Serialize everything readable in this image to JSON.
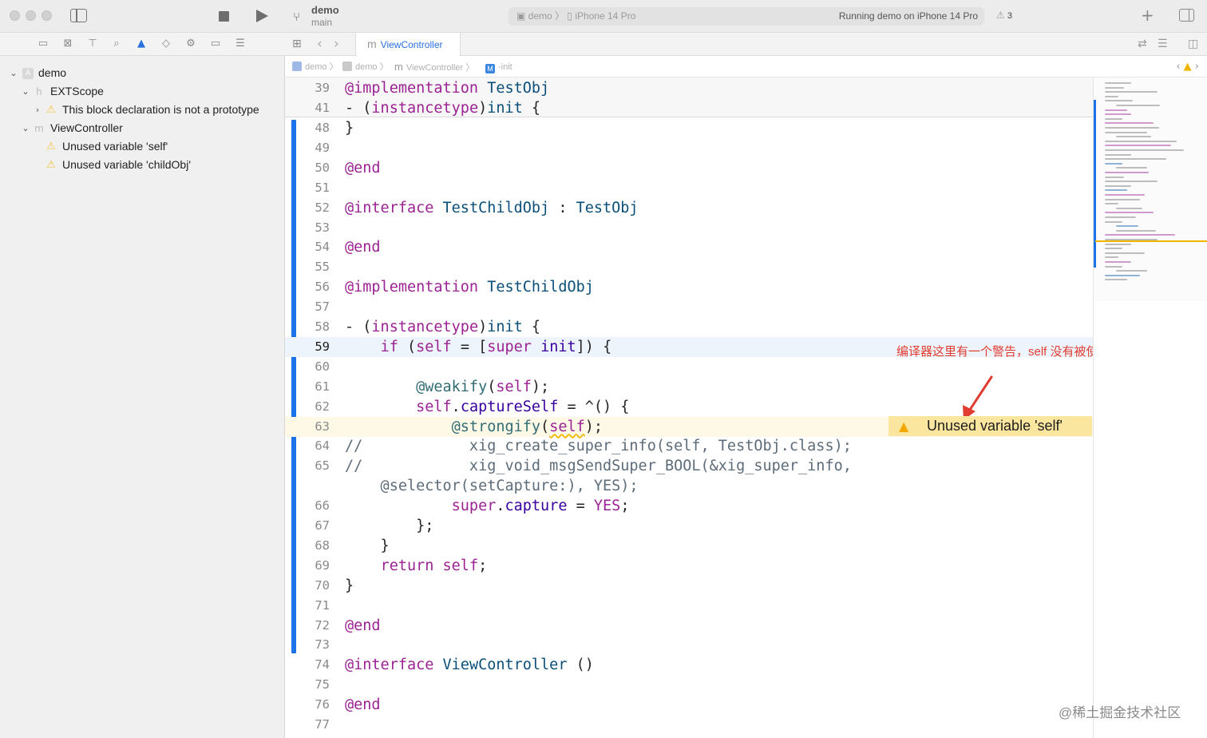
{
  "toolbar": {
    "scheme_name": "demo",
    "branch": "main",
    "activity_scheme": "demo",
    "activity_device": "iPhone 14 Pro",
    "activity_status": "Running demo on iPhone 14 Pro",
    "warning_count": "3"
  },
  "navigator": {
    "tree": [
      {
        "label": "demo",
        "kind": "project",
        "icon": "project-icon"
      },
      {
        "label": "EXTScope",
        "kind": "header-file",
        "icon": "header-file-icon"
      },
      {
        "label": "This block declaration is not a prototype",
        "kind": "warning",
        "icon": "warning-icon"
      },
      {
        "label": "ViewController",
        "kind": "source-file",
        "icon": "objc-file-icon"
      },
      {
        "label": "Unused variable 'self'",
        "kind": "warning",
        "icon": "warning-icon"
      },
      {
        "label": "Unused variable 'childObj'",
        "kind": "warning",
        "icon": "warning-icon"
      }
    ]
  },
  "tab": {
    "icon_letter": "m",
    "label": "ViewController"
  },
  "jumpbar": {
    "items": [
      "demo",
      "demo",
      "ViewController",
      "-init"
    ],
    "method_badge": "M"
  },
  "editor": {
    "sticky_lines": [
      {
        "num": "39",
        "segments": [
          {
            "t": "@implementation",
            "c": "kw"
          },
          {
            "t": " ",
            "c": ""
          },
          {
            "t": "TestObj",
            "c": "ty"
          }
        ]
      },
      {
        "num": "41",
        "segments": [
          {
            "t": "- (",
            "c": ""
          },
          {
            "t": "instancetype",
            "c": "kw"
          },
          {
            "t": ")",
            "c": ""
          },
          {
            "t": "init",
            "c": "ty"
          },
          {
            "t": " {",
            "c": ""
          }
        ]
      }
    ],
    "lines": [
      {
        "num": "48",
        "segments": [
          {
            "t": "}",
            "c": ""
          }
        ]
      },
      {
        "num": "49",
        "segments": []
      },
      {
        "num": "50",
        "segments": [
          {
            "t": "@end",
            "c": "kw"
          }
        ]
      },
      {
        "num": "51",
        "segments": []
      },
      {
        "num": "52",
        "segments": [
          {
            "t": "@interface",
            "c": "kw"
          },
          {
            "t": " ",
            "c": ""
          },
          {
            "t": "TestChildObj",
            "c": "ty"
          },
          {
            "t": " : ",
            "c": ""
          },
          {
            "t": "TestObj",
            "c": "ty"
          }
        ]
      },
      {
        "num": "53",
        "segments": []
      },
      {
        "num": "54",
        "segments": [
          {
            "t": "@end",
            "c": "kw"
          }
        ]
      },
      {
        "num": "55",
        "segments": []
      },
      {
        "num": "56",
        "segments": [
          {
            "t": "@implementation",
            "c": "kw"
          },
          {
            "t": " ",
            "c": ""
          },
          {
            "t": "TestChildObj",
            "c": "ty"
          }
        ]
      },
      {
        "num": "57",
        "segments": []
      },
      {
        "num": "58",
        "segments": [
          {
            "t": "- (",
            "c": ""
          },
          {
            "t": "instancetype",
            "c": "kw"
          },
          {
            "t": ")",
            "c": ""
          },
          {
            "t": "init",
            "c": "ty"
          },
          {
            "t": " {",
            "c": ""
          }
        ]
      },
      {
        "num": "59",
        "current": true,
        "segments": [
          {
            "t": "    ",
            "c": ""
          },
          {
            "t": "if",
            "c": "kw"
          },
          {
            "t": " (",
            "c": ""
          },
          {
            "t": "self",
            "c": "kw"
          },
          {
            "t": " = [",
            "c": ""
          },
          {
            "t": "super",
            "c": "kw"
          },
          {
            "t": " ",
            "c": ""
          },
          {
            "t": "init",
            "c": "pr"
          },
          {
            "t": "]) {",
            "c": ""
          }
        ]
      },
      {
        "num": "60",
        "segments": []
      },
      {
        "num": "61",
        "segments": [
          {
            "t": "        ",
            "c": ""
          },
          {
            "t": "@weakify",
            "c": "fn"
          },
          {
            "t": "(",
            "c": ""
          },
          {
            "t": "self",
            "c": "kw"
          },
          {
            "t": ");",
            "c": ""
          }
        ]
      },
      {
        "num": "62",
        "segments": [
          {
            "t": "        ",
            "c": ""
          },
          {
            "t": "self",
            "c": "kw"
          },
          {
            "t": ".",
            "c": ""
          },
          {
            "t": "captureSelf",
            "c": "pr"
          },
          {
            "t": " = ^() {",
            "c": ""
          }
        ]
      },
      {
        "num": "63",
        "warn": true,
        "segments": [
          {
            "t": "            ",
            "c": ""
          },
          {
            "t": "@strongify",
            "c": "fn"
          },
          {
            "t": "(",
            "c": ""
          },
          {
            "t": "self",
            "c": "kw uline"
          },
          {
            "t": ");",
            "c": ""
          }
        ]
      },
      {
        "num": "64",
        "segments": [
          {
            "t": "//            xig_create_super_info(self, TestObj.class);",
            "c": "cm"
          }
        ]
      },
      {
        "num": "65",
        "segments": [
          {
            "t": "//            xig_void_msgSendSuper_BOOL(&xig_super_info,",
            "c": "cm"
          }
        ]
      },
      {
        "num": "",
        "segments": [
          {
            "t": "    @selector(setCapture:), YES);",
            "c": "cm"
          }
        ]
      },
      {
        "num": "66",
        "segments": [
          {
            "t": "            ",
            "c": ""
          },
          {
            "t": "super",
            "c": "kw"
          },
          {
            "t": ".",
            "c": ""
          },
          {
            "t": "capture",
            "c": "pr"
          },
          {
            "t": " = ",
            "c": ""
          },
          {
            "t": "YES",
            "c": "kw"
          },
          {
            "t": ";",
            "c": ""
          }
        ]
      },
      {
        "num": "67",
        "segments": [
          {
            "t": "        };",
            "c": ""
          }
        ]
      },
      {
        "num": "68",
        "segments": [
          {
            "t": "    }",
            "c": ""
          }
        ]
      },
      {
        "num": "69",
        "segments": [
          {
            "t": "    ",
            "c": ""
          },
          {
            "t": "return",
            "c": "kw"
          },
          {
            "t": " ",
            "c": ""
          },
          {
            "t": "self",
            "c": "kw"
          },
          {
            "t": ";",
            "c": ""
          }
        ]
      },
      {
        "num": "70",
        "segments": [
          {
            "t": "}",
            "c": ""
          }
        ]
      },
      {
        "num": "71",
        "segments": []
      },
      {
        "num": "72",
        "segments": [
          {
            "t": "@end",
            "c": "kw"
          }
        ]
      },
      {
        "num": "73",
        "segments": []
      },
      {
        "num": "74",
        "segments": [
          {
            "t": "@interface",
            "c": "kw"
          },
          {
            "t": " ",
            "c": ""
          },
          {
            "t": "ViewController",
            "c": "ty"
          },
          {
            "t": " ()",
            "c": ""
          }
        ]
      },
      {
        "num": "75",
        "segments": []
      },
      {
        "num": "76",
        "segments": [
          {
            "t": "@end",
            "c": "kw"
          }
        ]
      },
      {
        "num": "77",
        "segments": []
      }
    ],
    "inline_warning": "Unused variable 'self'",
    "annotation": "编译器这里有一个警告，self 没有被使用"
  },
  "watermark": "@稀土掘金技术社区",
  "colors": {
    "accent": "#1a73e8",
    "warning": "#f1b500",
    "warning_badge_bg": "#fbe6a0",
    "annotation_red": "#e03c31",
    "keyword": "#9b2393",
    "type": "#0b4f79"
  }
}
